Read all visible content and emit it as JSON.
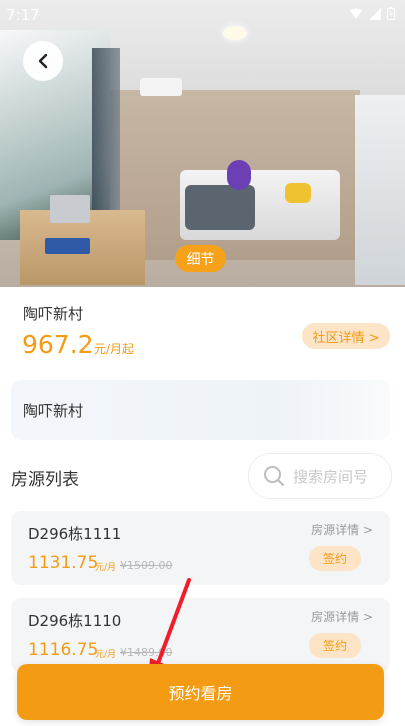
{
  "status": {
    "time": "7:17"
  },
  "hero": {
    "detail_label": "细节"
  },
  "listing": {
    "community": "陶吓新村",
    "price": "967.2",
    "price_unit": "元/月起",
    "community_detail": "社区详情 >",
    "address": "陶吓新村"
  },
  "room_list": {
    "title": "房源列表",
    "search_placeholder": "搜索房间号",
    "rooms": [
      {
        "name": "D296栋1111",
        "price": "1131.75",
        "unit": "元/月",
        "old_price": "¥1509.00",
        "detail": "房源详情 >",
        "action": "签约"
      },
      {
        "name": "D296栋1110",
        "price": "1116.75",
        "unit": "元/月",
        "old_price": "¥1489.00",
        "detail": "房源详情 >",
        "action": "签约"
      }
    ]
  },
  "footer": {
    "book_label": "预约看房"
  },
  "colors": {
    "accent": "#f39b12",
    "accent_light": "#fde4c6",
    "annotation": "#f01e2c"
  }
}
